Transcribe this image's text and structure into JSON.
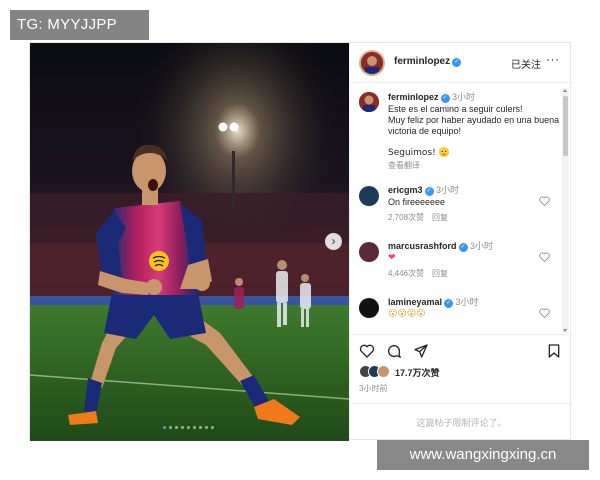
{
  "watermark": {
    "top": "TG: MYYJJPP",
    "bottom": "www.wangxingxing.cn"
  },
  "carousel": {
    "next_glyph": "›",
    "slide_count": 9,
    "active_slide": 1
  },
  "header": {
    "username": "fermin­lopez",
    "follow_label": "已关注",
    "more_glyph": "···"
  },
  "caption": {
    "username": "ferminlopez",
    "time": "3小时",
    "lines": [
      "Este es el camino a seguir culers!",
      "Muy feliz por haber ayudado en una buena victoria de equipo!",
      "",
      "Seguimos! 🫡"
    ],
    "translate_label": "查看翻译"
  },
  "comments": [
    {
      "username": "ericgm3",
      "time": "3小时",
      "text": "On fireeeeeee",
      "likes": "2,708次赞",
      "reply_label": "回复",
      "avatar_color": "#1d3a5a"
    },
    {
      "username": "marcusrashford",
      "time": "3小时",
      "text": "❤",
      "likes": "4,446次赞",
      "reply_label": "回复",
      "avatar_color": "#5a2a3a"
    },
    {
      "username": "lamineyamal",
      "time": "3小时",
      "text": "😮😮😮😮",
      "likes": "",
      "reply_label": "",
      "avatar_color": "#111111"
    }
  ],
  "actions": {
    "like_icon": "heart-icon",
    "comment_icon": "comment-icon",
    "share_icon": "share-icon",
    "save_icon": "bookmark-icon"
  },
  "likes": {
    "count_text": "17.7万次赞"
  },
  "post_time": "3小时前",
  "comments_closed_text": "这篇帖子限制评论了。",
  "colors": {
    "verified": "#3897f0",
    "accent_border": "#d9b38c",
    "heart": "#ed4956"
  }
}
